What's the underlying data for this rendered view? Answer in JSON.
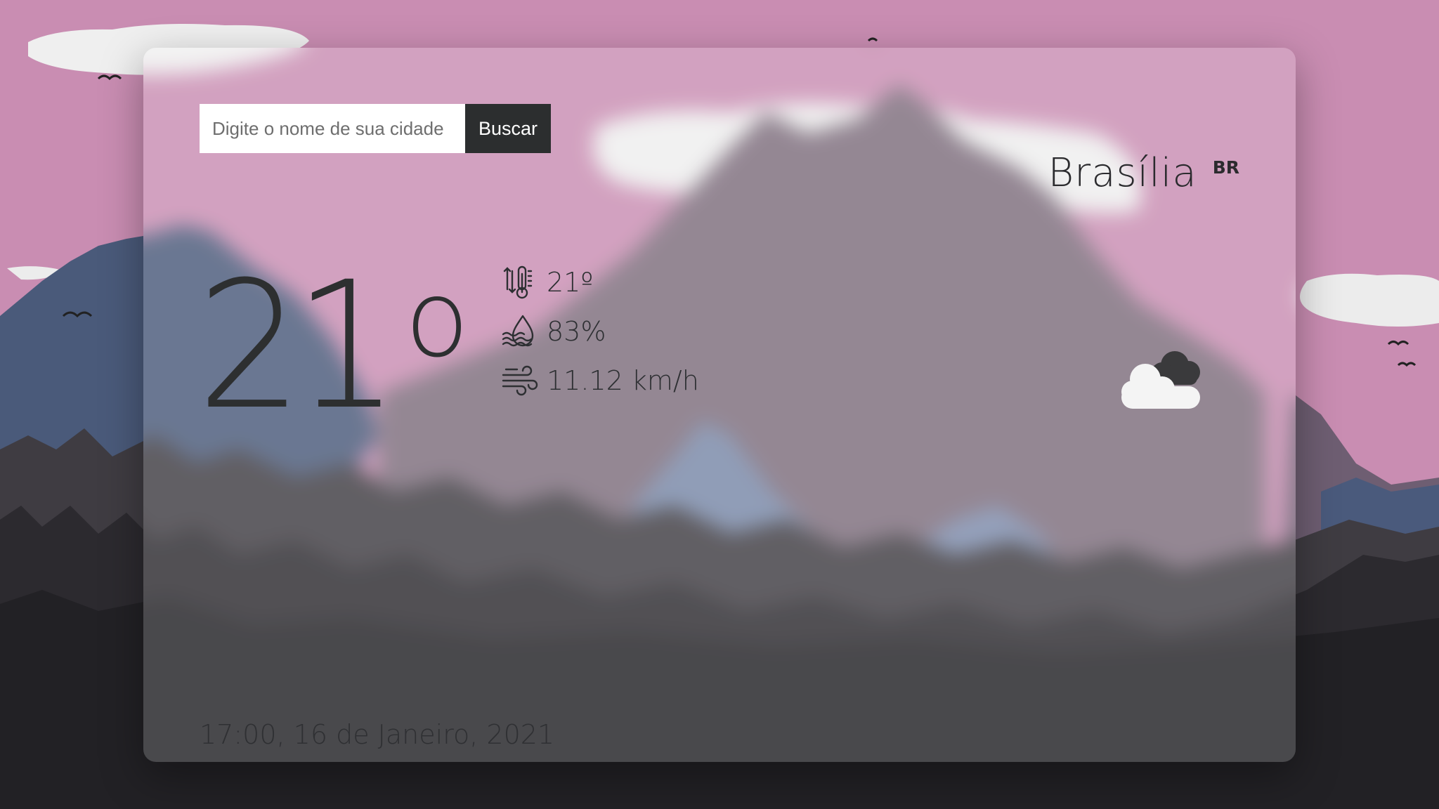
{
  "search": {
    "placeholder": "Digite o nome de sua cidade",
    "button_label": "Buscar"
  },
  "location": {
    "city": "Brasília",
    "country": "BR"
  },
  "current": {
    "temperature": "21",
    "degree_symbol": "o",
    "feels_like": "21º",
    "humidity": "83%",
    "wind": "11.12 km/h",
    "condition_icon": "cloud-icon"
  },
  "datetime": "17:00, 16 de Janeiro, 2021",
  "icons": {
    "feels_like": "thermometer-icon",
    "humidity": "humidity-drop-icon",
    "wind": "wind-icon"
  },
  "colors": {
    "sky": "#c98db2",
    "text_dark": "#2d2f30",
    "button_bg": "#2c2e2f",
    "cloud_white": "#f2f2f2"
  }
}
